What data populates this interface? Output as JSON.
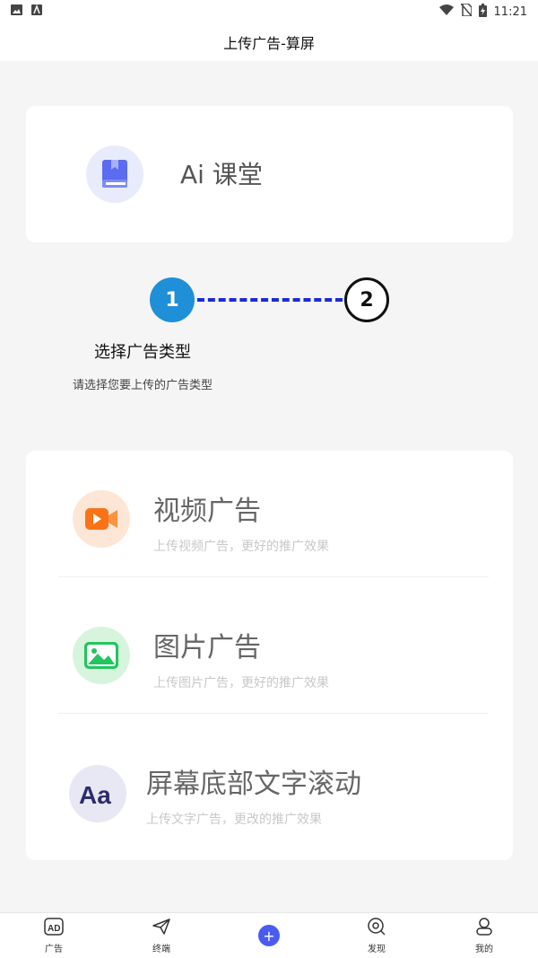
{
  "status_bar": {
    "time": "11:21"
  },
  "header": {
    "title": "上传广告-算屏"
  },
  "course_card": {
    "title": "Ai 课堂",
    "icon": "book-icon"
  },
  "stepper": {
    "step1_number": "1",
    "step2_number": "2",
    "current_label": "选择广告类型",
    "current_desc": "请选择您要上传的广告类型",
    "active_color": "#1f8fd8",
    "line_color": "#1a2bd6"
  },
  "ad_types": [
    {
      "title": "视频广告",
      "desc": "上传视频广告，更好的推广效果",
      "icon": "video-camera-icon",
      "icon_color": "#f97316"
    },
    {
      "title": "图片广告",
      "desc": "上传图片广告，更好的推广效果",
      "icon": "image-icon",
      "icon_color": "#22c55e"
    },
    {
      "title": "屏幕底部文字滚动",
      "desc": "上传文字广告，更改的推广效果",
      "icon": "text-aa-icon",
      "icon_color": "#2d2d6b"
    }
  ],
  "tabbar": {
    "items": [
      {
        "label": "广告",
        "icon": "ad-icon"
      },
      {
        "label": "终端",
        "icon": "paper-plane-icon"
      },
      {
        "label": "",
        "icon": "plus-icon"
      },
      {
        "label": "发现",
        "icon": "discover-icon"
      },
      {
        "label": "我的",
        "icon": "user-icon"
      }
    ],
    "accent": "#4a5cf0"
  }
}
